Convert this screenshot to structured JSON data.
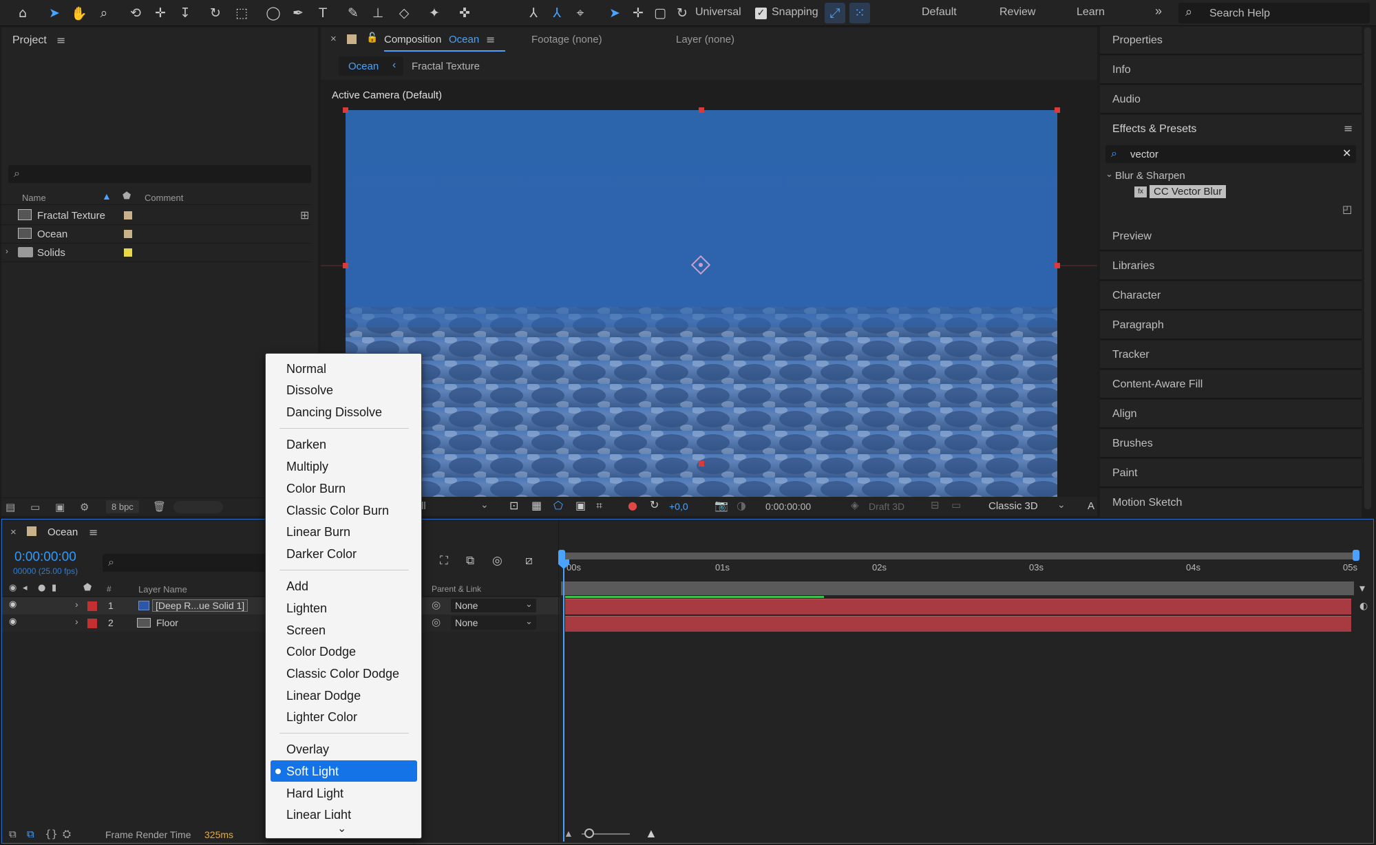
{
  "toolbar": {
    "universal_label": "Universal",
    "snapping_label": "Snapping",
    "workspaces": [
      "Default",
      "Review",
      "Learn"
    ],
    "more": "»",
    "search_placeholder": "Search Help"
  },
  "project": {
    "title": "Project",
    "search": "",
    "columns": {
      "name": "Name",
      "comment": "Comment"
    },
    "items": [
      {
        "name": "Fractal Texture",
        "color": "#c9b28a"
      },
      {
        "name": "Ocean",
        "color": "#c9b28a"
      },
      {
        "name": "Solids",
        "color": "#e8d84a"
      }
    ],
    "bpc": "8 bpc"
  },
  "comp": {
    "close": "×",
    "title_prefix": "Composition",
    "title_name": "Ocean",
    "footage": "Footage (none)",
    "layer": "Layer (none)",
    "breadcrumb": [
      "Ocean",
      "Fractal Texture"
    ],
    "camera_label": "Active Camera (Default)",
    "resolution_fragment": "ll",
    "exposure": "+0,0",
    "timecode": "0:00:00:00",
    "draft3d": "Draft 3D",
    "renderer": "Classic 3D",
    "last": "A"
  },
  "right_panels": [
    "Properties",
    "Info",
    "Audio",
    "Effects & Presets",
    "Preview",
    "Libraries",
    "Character",
    "Paragraph",
    "Tracker",
    "Content-Aware Fill",
    "Align",
    "Brushes",
    "Paint",
    "Motion Sketch"
  ],
  "effects": {
    "search": "vector",
    "category": "Blur & Sharpen",
    "effect": "CC Vector Blur"
  },
  "timeline": {
    "tab": "Ocean",
    "timecode": "0:00:00:00",
    "fps": "00000 (25.00 fps)",
    "columns": {
      "number": "#",
      "layer_name": "Layer Name",
      "parent": "Parent & Link"
    },
    "layers": [
      {
        "num": "1",
        "name": "[Deep R...ue Solid 1]",
        "parent": "None",
        "label_color": "#c43030"
      },
      {
        "num": "2",
        "name": "Floor",
        "parent": "None",
        "label_color": "#c43030"
      }
    ],
    "ruler": [
      "00s",
      "01s",
      "02s",
      "03s",
      "04s",
      "05s"
    ],
    "frame_render_label": "Frame Render Time",
    "frame_render_value": "325ms"
  },
  "menu": {
    "groups": [
      [
        "Normal",
        "Dissolve",
        "Dancing Dissolve"
      ],
      [
        "Darken",
        "Multiply",
        "Color Burn",
        "Classic Color Burn",
        "Linear Burn",
        "Darker Color"
      ],
      [
        "Add",
        "Lighten",
        "Screen",
        "Color Dodge",
        "Classic Color Dodge",
        "Linear Dodge",
        "Lighter Color"
      ],
      [
        "Overlay",
        "Soft Light",
        "Hard Light",
        "Linear Light"
      ]
    ],
    "selected": "Soft Light"
  },
  "colors": {
    "accent": "#1473e6",
    "timecode_blue": "#2d9cff",
    "layer_bar": "#a83a42"
  }
}
